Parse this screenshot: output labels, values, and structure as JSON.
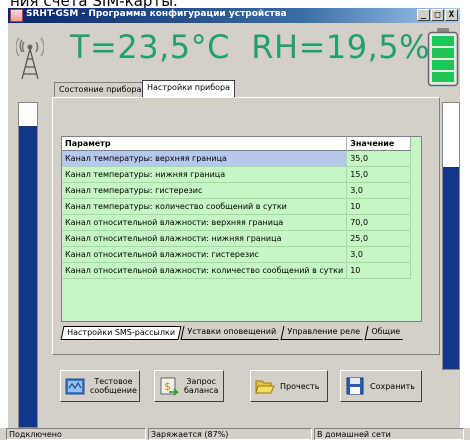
{
  "background_text": "ния счета SIM-карты.",
  "window": {
    "title": "SRHT-GSM - Программа конфигурации устройства",
    "controls": [
      "_",
      "□",
      "X"
    ]
  },
  "header": {
    "temperature_label": "T=23,5°C",
    "humidity_label": "RH=19,5%",
    "signal_icon": "antenna-tower-icon",
    "battery_icon": "battery-full-icon",
    "battery_level": 1.0
  },
  "side_indicators": {
    "left_level": 0.93,
    "right_level": 0.76
  },
  "tabs": [
    "Состояние прибора",
    "Настройки прибора"
  ],
  "active_tab": 1,
  "table": {
    "headers": [
      "Параметр",
      "Значение"
    ],
    "rows": [
      {
        "param": "Канал температуры: верхняя граница",
        "value": "35,0"
      },
      {
        "param": "Канал температуры: нижняя граница",
        "value": "15,0"
      },
      {
        "param": "Канал температуры: гистерезис",
        "value": "3,0"
      },
      {
        "param": "Канал температуры: количество сообщений в сутки",
        "value": "10"
      },
      {
        "param": "Канал относительной влажности: верхняя граница",
        "value": "70,0"
      },
      {
        "param": "Канал относительной влажности: нижняя граница",
        "value": "25,0"
      },
      {
        "param": "Канал относительной влажности: гистерезис",
        "value": "3,0"
      },
      {
        "param": "Канал относительной влажности: количество сообщений в сутки",
        "value": "10"
      }
    ],
    "selected_row": 0
  },
  "sub_tabs": [
    "Настройки SMS-рассылки",
    "Уставки оповещений",
    "Управление реле",
    "Общие"
  ],
  "active_sub_tab": 0,
  "buttons": {
    "test_message": "Тестовое\nсообщение",
    "balance_request": "Запрос\nбаланса",
    "read": "Прочесть",
    "save": "Сохранить"
  },
  "status": {
    "connection": "Подключено",
    "charging": "Заряжается (87%)",
    "network": "В домашней сети"
  },
  "colors": {
    "readout": "#22a06a",
    "table_bg": "#c6f5c6",
    "selection": "#b6c8ec",
    "indicator": "#14378c",
    "battery": "#22c45a"
  }
}
